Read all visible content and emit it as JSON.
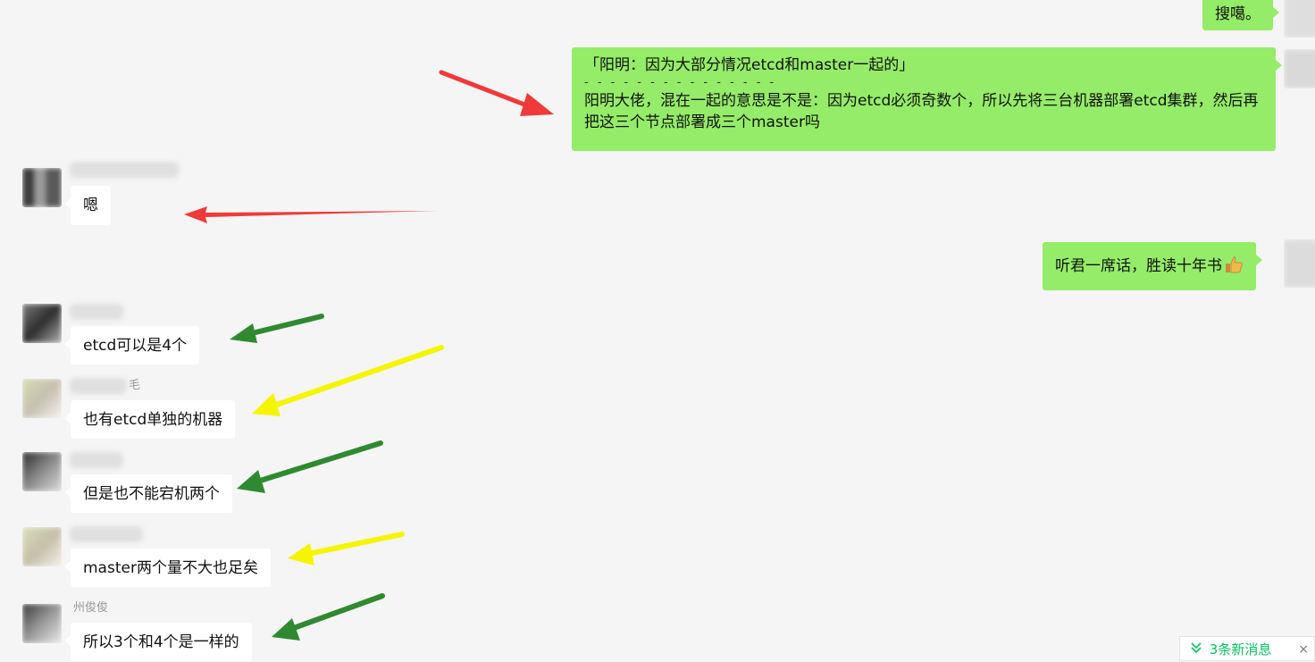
{
  "messages": {
    "m1": {
      "text": "搜噶。"
    },
    "m2": {
      "quote": "「阳明：因为大部分情况etcd和master一起的」",
      "separator": "- - - - - - - - - - - - - - -",
      "reply": "阳明大佬，混在一起的意思是不是：因为etcd必须奇数个，所以先将三台机器部署etcd集群，然后再把这三个节点部署成三个master吗"
    },
    "m3": {
      "sender": "",
      "text": "嗯"
    },
    "m4": {
      "text": "听君一席话，胜读十年书"
    },
    "m5": {
      "sender": "",
      "text": "etcd可以是4个"
    },
    "m6": {
      "sender": "毛",
      "text": "也有etcd单独的机器"
    },
    "m7": {
      "sender": "",
      "text": "但是也不能宕机两个"
    },
    "m8": {
      "sender": "",
      "text": "master两个量不大也足矣"
    },
    "m9": {
      "sender": "州俊俊",
      "text": "所以3个和4个是一样的"
    }
  },
  "new_messages": {
    "label": "3条新消息",
    "icon": "double-chevron-down-icon",
    "close": "×"
  },
  "colors": {
    "background": "#f5f5f5",
    "outgoing_bubble": "#95ec69",
    "incoming_bubble": "#ffffff",
    "arrow_red": "#f03a3a",
    "arrow_green": "#2f8a2f",
    "arrow_yellow": "#f5f500",
    "accent": "#07c160"
  }
}
